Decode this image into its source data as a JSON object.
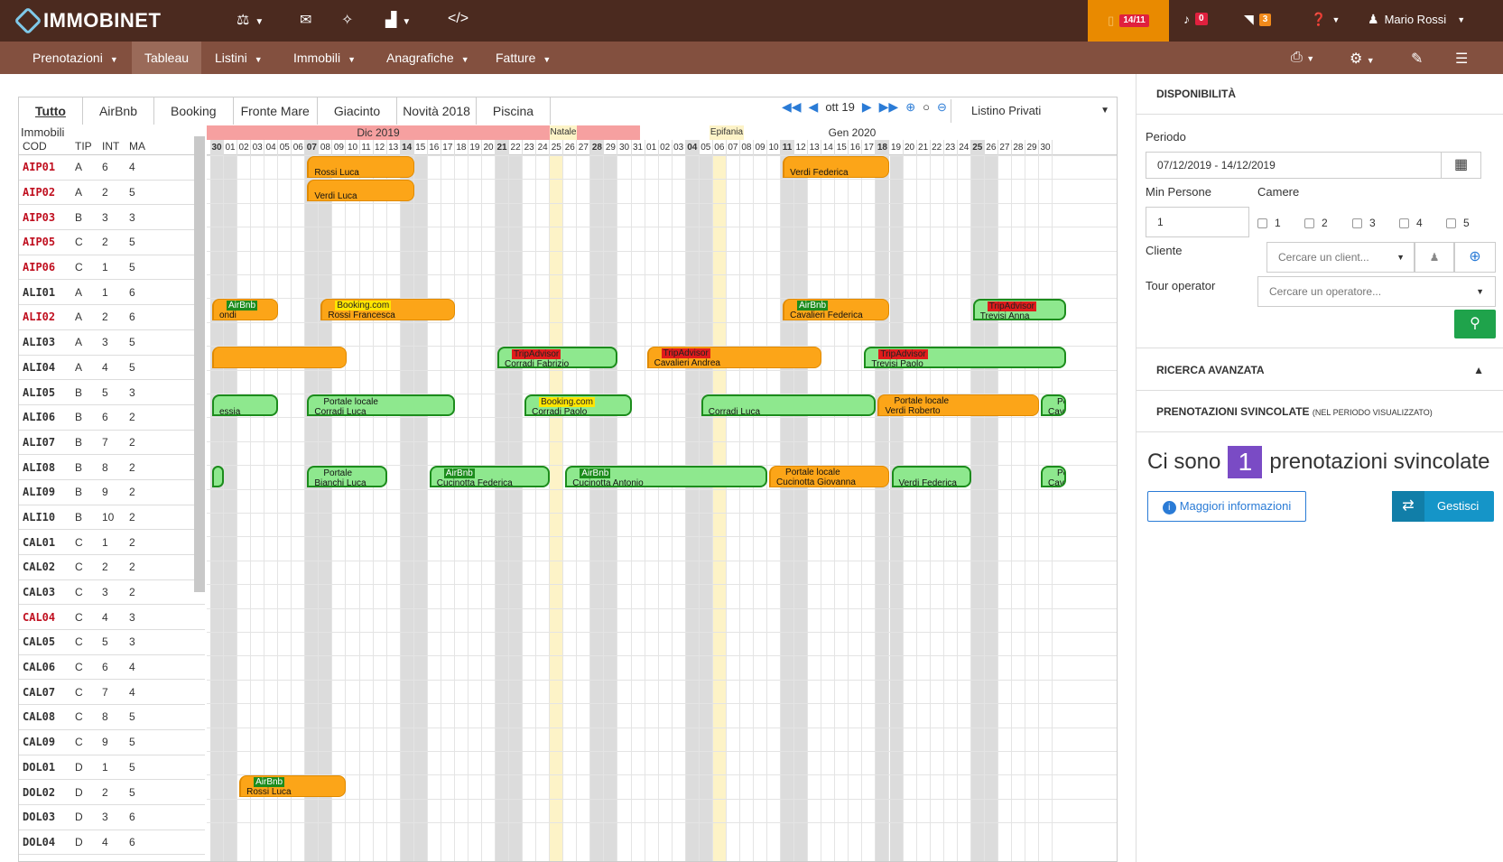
{
  "brand": "IMMOBINET",
  "topbar": {
    "counter": "14/11",
    "notifications": "0",
    "feeds": "3",
    "user": "Mario Rossi"
  },
  "nav": [
    "Prenotazioni",
    "Tableau",
    "Listini",
    "Immobili",
    "Anagrafiche",
    "Fatture"
  ],
  "tabs": [
    "Tutto",
    "AirBnb",
    "Booking",
    "Fronte Mare",
    "Giacinto",
    "Novità 2018",
    "Piscina"
  ],
  "controls": {
    "period": "ott 19",
    "listino": "Listino Privati"
  },
  "left_header": {
    "title": "Immobili",
    "cod": "COD",
    "tip": "TIP",
    "int": "INT",
    "ma": "MA"
  },
  "units": [
    {
      "cod": "AIP01",
      "tip": "A",
      "int": "6",
      "ma": "4",
      "red": true
    },
    {
      "cod": "AIP02",
      "tip": "A",
      "int": "2",
      "ma": "5",
      "red": true
    },
    {
      "cod": "AIP03",
      "tip": "B",
      "int": "3",
      "ma": "3",
      "red": true
    },
    {
      "cod": "AIP05",
      "tip": "C",
      "int": "2",
      "ma": "5",
      "red": true
    },
    {
      "cod": "AIP06",
      "tip": "C",
      "int": "1",
      "ma": "5",
      "red": true
    },
    {
      "cod": "ALI01",
      "tip": "A",
      "int": "1",
      "ma": "6",
      "red": false
    },
    {
      "cod": "ALI02",
      "tip": "A",
      "int": "2",
      "ma": "6",
      "red": true
    },
    {
      "cod": "ALI03",
      "tip": "A",
      "int": "3",
      "ma": "5",
      "red": false
    },
    {
      "cod": "ALI04",
      "tip": "A",
      "int": "4",
      "ma": "5",
      "red": false
    },
    {
      "cod": "ALI05",
      "tip": "B",
      "int": "5",
      "ma": "3",
      "red": false
    },
    {
      "cod": "ALI06",
      "tip": "B",
      "int": "6",
      "ma": "2",
      "red": false
    },
    {
      "cod": "ALI07",
      "tip": "B",
      "int": "7",
      "ma": "2",
      "red": false
    },
    {
      "cod": "ALI08",
      "tip": "B",
      "int": "8",
      "ma": "2",
      "red": false
    },
    {
      "cod": "ALI09",
      "tip": "B",
      "int": "9",
      "ma": "2",
      "red": false
    },
    {
      "cod": "ALI10",
      "tip": "B",
      "int": "10",
      "ma": "2",
      "red": false
    },
    {
      "cod": "CAL01",
      "tip": "C",
      "int": "1",
      "ma": "2",
      "red": false
    },
    {
      "cod": "CAL02",
      "tip": "C",
      "int": "2",
      "ma": "2",
      "red": false
    },
    {
      "cod": "CAL03",
      "tip": "C",
      "int": "3",
      "ma": "2",
      "red": false
    },
    {
      "cod": "CAL04",
      "tip": "C",
      "int": "4",
      "ma": "3",
      "red": true
    },
    {
      "cod": "CAL05",
      "tip": "C",
      "int": "5",
      "ma": "3",
      "red": false
    },
    {
      "cod": "CAL06",
      "tip": "C",
      "int": "6",
      "ma": "4",
      "red": false
    },
    {
      "cod": "CAL07",
      "tip": "C",
      "int": "7",
      "ma": "4",
      "red": false
    },
    {
      "cod": "CAL08",
      "tip": "C",
      "int": "8",
      "ma": "5",
      "red": false
    },
    {
      "cod": "CAL09",
      "tip": "C",
      "int": "9",
      "ma": "5",
      "red": false
    },
    {
      "cod": "DOL01",
      "tip": "D",
      "int": "1",
      "ma": "5",
      "red": false
    },
    {
      "cod": "DOL02",
      "tip": "D",
      "int": "2",
      "ma": "5",
      "red": false
    },
    {
      "cod": "DOL03",
      "tip": "D",
      "int": "3",
      "ma": "6",
      "red": false
    },
    {
      "cod": "DOL04",
      "tip": "D",
      "int": "4",
      "ma": "6",
      "red": false
    }
  ],
  "calendar": {
    "months": [
      "Dic 2019",
      "Gen 2020"
    ],
    "holidays": [
      "Natale",
      "Epifania"
    ],
    "days": [
      "30",
      "01",
      "02",
      "03",
      "04",
      "05",
      "06",
      "07",
      "08",
      "09",
      "10",
      "11",
      "12",
      "13",
      "14",
      "15",
      "16",
      "17",
      "18",
      "19",
      "20",
      "21",
      "22",
      "23",
      "24",
      "25",
      "26",
      "27",
      "28",
      "29",
      "30",
      "31",
      "01",
      "02",
      "03",
      "04",
      "05",
      "06",
      "07",
      "08",
      "09",
      "10",
      "11",
      "12",
      "13",
      "14",
      "15",
      "16",
      "17",
      "18",
      "19",
      "20",
      "21",
      "22",
      "23",
      "24",
      "25",
      "26",
      "27",
      "28",
      "29",
      "30"
    ],
    "bold_days": [
      0,
      7,
      14,
      21,
      28,
      35,
      42,
      49,
      56
    ]
  },
  "bookings": [
    {
      "row": 0,
      "start": 7,
      "len": 8,
      "color": "orange",
      "source": "",
      "name": "Rossi Luca"
    },
    {
      "row": 0,
      "start": 42,
      "len": 8,
      "color": "orange",
      "source": "",
      "name": "Verdi Federica"
    },
    {
      "row": 1,
      "start": 7,
      "len": 8,
      "color": "orange",
      "source": "",
      "name": "Verdi Luca"
    },
    {
      "row": 6,
      "start": 0,
      "len": 5,
      "color": "orange",
      "source": "AirBnb",
      "srctype": "airbnb",
      "name": "ondi"
    },
    {
      "row": 6,
      "start": 8,
      "len": 10,
      "color": "orange",
      "source": "Booking.com",
      "srctype": "booking",
      "name": "Rossi Francesca"
    },
    {
      "row": 6,
      "start": 42,
      "len": 8,
      "color": "orange",
      "source": "AirBnb",
      "srctype": "airbnb",
      "name": "Cavalieri Federica"
    },
    {
      "row": 6,
      "start": 56,
      "len": 7,
      "color": "green",
      "source": "TripAdvisor",
      "srctype": "trip",
      "name": "Trevisi Anna"
    },
    {
      "row": 8,
      "start": 0,
      "len": 10,
      "color": "orange",
      "source": "",
      "name": ""
    },
    {
      "row": 8,
      "start": 21,
      "len": 9,
      "color": "green",
      "source": "TripAdvisor",
      "srctype": "trip",
      "name": "Corradi Fabrizio"
    },
    {
      "row": 8,
      "start": 32,
      "len": 13,
      "color": "orange",
      "source": "TripAdvisor",
      "srctype": "trip",
      "name": "Cavalieri Andrea"
    },
    {
      "row": 8,
      "start": 48,
      "len": 15,
      "color": "green",
      "source": "TripAdvisor",
      "srctype": "trip",
      "name": "Trevisi Paolo"
    },
    {
      "row": 10,
      "start": 0,
      "len": 5,
      "color": "green",
      "source": "",
      "name": "essia"
    },
    {
      "row": 10,
      "start": 7,
      "len": 11,
      "color": "green",
      "source": "Portale locale",
      "srctype": "local",
      "name": "Corradi Luca"
    },
    {
      "row": 10,
      "start": 23,
      "len": 8,
      "color": "green",
      "source": "Booking.com",
      "srctype": "booking",
      "name": "Corradi Paolo"
    },
    {
      "row": 10,
      "start": 36,
      "len": 13,
      "color": "green",
      "source": "",
      "name": "Corradi Luca"
    },
    {
      "row": 10,
      "start": 49,
      "len": 12,
      "color": "orange",
      "source": "Portale locale",
      "srctype": "local",
      "name": "Verdi Roberto"
    },
    {
      "row": 10,
      "start": 61,
      "len": 2,
      "color": "green",
      "source": "Portale locale",
      "srctype": "local",
      "name": "Cav"
    },
    {
      "row": 13,
      "start": 0,
      "len": 1,
      "color": "green",
      "source": "",
      "name": ""
    },
    {
      "row": 13,
      "start": 7,
      "len": 6,
      "color": "green",
      "source": "Portale",
      "srctype": "local",
      "name": "Bianchi Luca"
    },
    {
      "row": 13,
      "start": 16,
      "len": 9,
      "color": "green",
      "source": "AirBnb",
      "srctype": "airbnb",
      "name": "Cucinotta Federica"
    },
    {
      "row": 13,
      "start": 26,
      "len": 15,
      "color": "green",
      "source": "AirBnb",
      "srctype": "airbnb",
      "name": "Cucinotta Antonio"
    },
    {
      "row": 13,
      "start": 41,
      "len": 9,
      "color": "orange",
      "source": "Portale locale",
      "srctype": "local",
      "name": "Cucinotta Giovanna"
    },
    {
      "row": 13,
      "start": 50,
      "len": 6,
      "color": "green",
      "source": "",
      "name": "Verdi Federica"
    },
    {
      "row": 13,
      "start": 61,
      "len": 2,
      "color": "green",
      "source": "Portale locale",
      "srctype": "local",
      "name": "Cav"
    },
    {
      "row": 26,
      "start": 2,
      "len": 8,
      "color": "orange",
      "source": "AirBnb",
      "srctype": "airbnb",
      "name": "Rossi Luca"
    }
  ],
  "right": {
    "disponibilita": "DISPONIBILITÀ",
    "periodo_label": "Periodo",
    "periodo_value": "07/12/2019 - 14/12/2019",
    "min_persone_label": "Min Persone",
    "min_persone_value": "1",
    "camere_label": "Camere",
    "camere": [
      "1",
      "2",
      "3",
      "4",
      "5"
    ],
    "cliente_label": "Cliente",
    "cliente_placeholder": "Cercare un client...",
    "tour_label": "Tour operator",
    "tour_placeholder": "Cercare un operatore...",
    "advanced": "RICERCA AVANZATA",
    "svincolate_title": "PRENOTAZIONI SVINCOLATE",
    "svincolate_note": "(NEL PERIODO VISUALIZZATO)",
    "msg_pre": "Ci sono",
    "msg_num": "1",
    "msg_post": "prenotazioni svincolate",
    "info_btn": "Maggiori informazioni",
    "manage_btn": "Gestisci"
  }
}
